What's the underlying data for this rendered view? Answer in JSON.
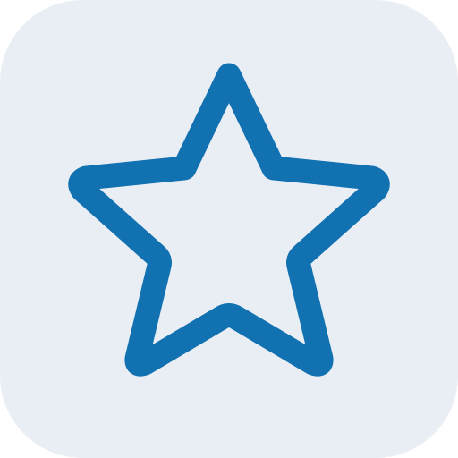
{
  "icon": {
    "name": "star-outline-icon",
    "tile_color": "#e9eef5",
    "stroke_color": "#1271b0",
    "filled": false
  }
}
